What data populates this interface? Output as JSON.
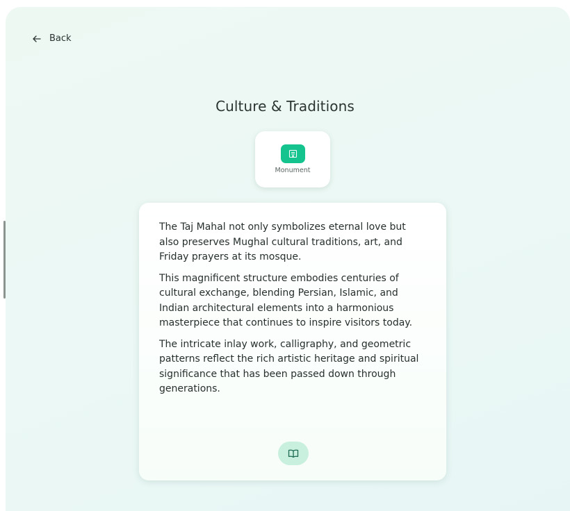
{
  "nav": {
    "back_label": "Back"
  },
  "page": {
    "title": "Culture & Traditions"
  },
  "badge": {
    "icon": "monument-icon",
    "label": "Monument"
  },
  "content": {
    "paragraphs": [
      "The Taj Mahal not only symbolizes eternal love but also preserves Mughal cultural traditions, art, and Friday prayers at its mosque.",
      "This magnificent structure embodies centuries of cultural exchange, blending Persian, Islamic, and Indian architectural elements into a harmonious masterpiece that continues to inspire visitors today.",
      "The intricate inlay work, calligraphy, and geometric patterns reflect the rich artistic heritage and spiritual significance that has been passed down through generations."
    ],
    "read_icon": "book-open-icon"
  },
  "colors": {
    "accent": "#14c38e",
    "accent_soft": "#c9f0df",
    "background": "#ecf8f5"
  }
}
